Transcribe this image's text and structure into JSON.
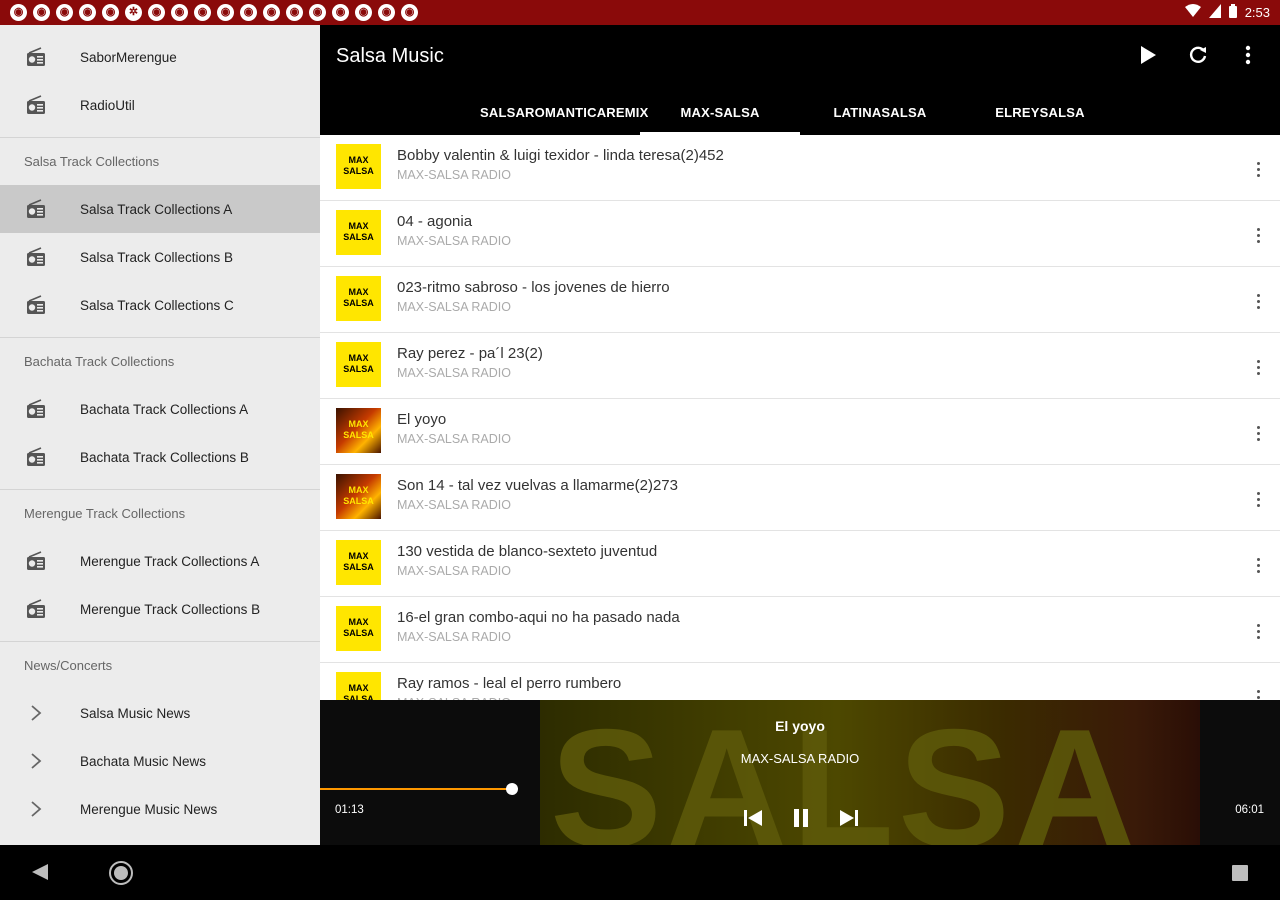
{
  "status_bar": {
    "time": "2:53",
    "left_icons": [
      "◉",
      "◉",
      "◉",
      "◉",
      "◉",
      "✲",
      "◉",
      "◉",
      "◉",
      "◉",
      "◉",
      "◉",
      "◉",
      "◉",
      "◉",
      "◉",
      "◉",
      "◉"
    ]
  },
  "drawer": {
    "top_items": [
      {
        "label": "SaborMerengue",
        "icon": "radio-icon"
      },
      {
        "label": "RadioUtil",
        "icon": "radio-icon"
      }
    ],
    "sections": [
      {
        "header": "Salsa Track Collections",
        "items": [
          {
            "label": "Salsa Track Collections A",
            "icon": "radio-icon",
            "active": true
          },
          {
            "label": "Salsa Track Collections B",
            "icon": "radio-icon"
          },
          {
            "label": "Salsa Track Collections C",
            "icon": "radio-icon"
          }
        ]
      },
      {
        "header": "Bachata Track Collections",
        "items": [
          {
            "label": "Bachata Track Collections A",
            "icon": "radio-icon"
          },
          {
            "label": "Bachata Track Collections B",
            "icon": "radio-icon"
          }
        ]
      },
      {
        "header": "Merengue Track Collections",
        "items": [
          {
            "label": "Merengue Track Collections A",
            "icon": "radio-icon"
          },
          {
            "label": "Merengue Track Collections B",
            "icon": "radio-icon"
          }
        ]
      },
      {
        "header": "News/Concerts",
        "items": [
          {
            "label": "Salsa Music News",
            "icon": "chevron-right-icon"
          },
          {
            "label": "Bachata Music News",
            "icon": "chevron-right-icon"
          },
          {
            "label": "Merengue Music News",
            "icon": "chevron-right-icon"
          }
        ]
      }
    ]
  },
  "appbar": {
    "title": "Salsa Music",
    "tabs": [
      {
        "label": "SALSAROMANTICAREMIX"
      },
      {
        "label": "MAX-SALSA",
        "active": true
      },
      {
        "label": "LATINASALSA"
      },
      {
        "label": "ELREYSALSA"
      }
    ]
  },
  "tracks": [
    {
      "title": "Bobby valentin & luigi texidor - linda teresa(2)452",
      "subtitle": "MAX-SALSA RADIO",
      "art": "MAX\nSALSA",
      "art_style": "yellow"
    },
    {
      "title": "04 - agonia",
      "subtitle": "MAX-SALSA RADIO",
      "art": "MAX\nSALSA",
      "art_style": "yellow"
    },
    {
      "title": "023-ritmo sabroso - los jovenes de hierro",
      "subtitle": "MAX-SALSA RADIO",
      "art": "MAX\nSALSA",
      "art_style": "yellow"
    },
    {
      "title": "Ray perez - pa´l 23(2)",
      "subtitle": "MAX-SALSA RADIO",
      "art": "MAX\nSALSA",
      "art_style": "yellow"
    },
    {
      "title": "El yoyo",
      "subtitle": "MAX-SALSA RADIO",
      "art": "MAX\nSALSA",
      "art_style": "dark"
    },
    {
      "title": "Son 14 - tal vez vuelvas a llamarme(2)273",
      "subtitle": "MAX-SALSA RADIO",
      "art": "MAX\nSALSA",
      "art_style": "dark"
    },
    {
      "title": "130 vestida de blanco-sexteto juventud",
      "subtitle": "MAX-SALSA RADIO",
      "art": "MAX\nSALSA",
      "art_style": "yellow"
    },
    {
      "title": "16-el gran combo-aqui no ha pasado nada",
      "subtitle": "MAX-SALSA RADIO",
      "art": "MAX\nSALSA",
      "art_style": "yellow"
    },
    {
      "title": "Ray ramos - leal el perro rumbero",
      "subtitle": "MAX-SALSA RADIO",
      "art": "MAX\nSALSA",
      "art_style": "yellow"
    }
  ],
  "player": {
    "title": "El yoyo",
    "subtitle": "MAX-SALSA RADIO",
    "background_text": "SALSA",
    "elapsed": "01:13",
    "duration": "06:01",
    "progress": 0.2
  },
  "colors": {
    "status_bar": "#8a0a0a",
    "accent": "#ff9800",
    "art_yellow": "#ffe600"
  }
}
